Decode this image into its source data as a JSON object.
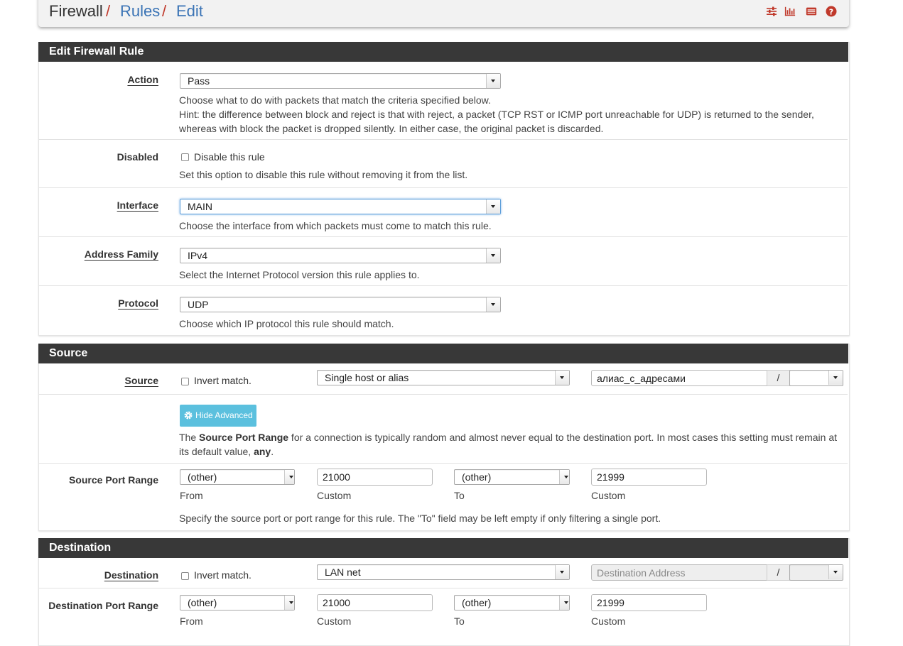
{
  "breadcrumb": {
    "firewall": "Firewall",
    "rules": "Rules",
    "edit": "Edit",
    "sep": "/"
  },
  "header_icons": [
    "sliders-icon",
    "bar-chart-icon",
    "list-icon",
    "help-icon"
  ],
  "colors": {
    "accent_red": "#c0392b",
    "link_blue": "#3a73b5",
    "panel_header": "#383838",
    "info_button": "#5bc0de"
  },
  "edit_panel": {
    "title": "Edit Firewall Rule",
    "action": {
      "label": "Action",
      "value": "Pass",
      "help1": "Choose what to do with packets that match the criteria specified below.",
      "help2": "Hint: the difference between block and reject is that with reject, a packet (TCP RST or ICMP port unreachable for UDP) is returned to the sender,",
      "help3": "whereas with block the packet is dropped silently. In either case, the original packet is discarded."
    },
    "disabled": {
      "label": "Disabled",
      "checkbox_label": "Disable this rule",
      "help": "Set this option to disable this rule without removing it from the list."
    },
    "interface": {
      "label": "Interface",
      "value": "MAIN",
      "help": "Choose the interface from which packets must come to match this rule."
    },
    "address_family": {
      "label": "Address Family",
      "value": "IPv4",
      "help": "Select the Internet Protocol version this rule applies to."
    },
    "protocol": {
      "label": "Protocol",
      "value": "UDP",
      "help": "Choose which IP protocol this rule should match."
    }
  },
  "source_panel": {
    "title": "Source",
    "source": {
      "label": "Source",
      "invert_label": "Invert match.",
      "type_value": "Single host or alias",
      "address_value": "алиас_с_адресами",
      "slash": "/",
      "mask_value": ""
    },
    "advanced_button": "Hide Advanced",
    "advanced_help_pre": "The ",
    "advanced_help_bold": "Source Port Range",
    "advanced_help_mid": " for a connection is typically random and almost never equal to the destination port. In most cases this setting must remain at",
    "advanced_help_line2_pre": "its default value, ",
    "advanced_help_line2_bold": "any",
    "advanced_help_line2_post": ".",
    "port_range": {
      "label": "Source Port Range",
      "from_select": "(other)",
      "from_custom": "21000",
      "to_select": "(other)",
      "to_custom": "21999",
      "from_caption": "From",
      "custom_caption": "Custom",
      "to_caption": "To",
      "help": "Specify the source port or port range for this rule. The \"To\" field may be left empty if only filtering a single port."
    }
  },
  "destination_panel": {
    "title": "Destination",
    "destination": {
      "label": "Destination",
      "invert_label": "Invert match.",
      "type_value": "LAN net",
      "address_placeholder": "Destination Address",
      "slash": "/",
      "mask_value": ""
    },
    "port_range": {
      "label": "Destination Port Range",
      "from_select": "(other)",
      "from_custom": "21000",
      "to_select": "(other)",
      "to_custom": "21999",
      "from_caption": "From",
      "custom_caption": "Custom",
      "to_caption": "To"
    }
  }
}
